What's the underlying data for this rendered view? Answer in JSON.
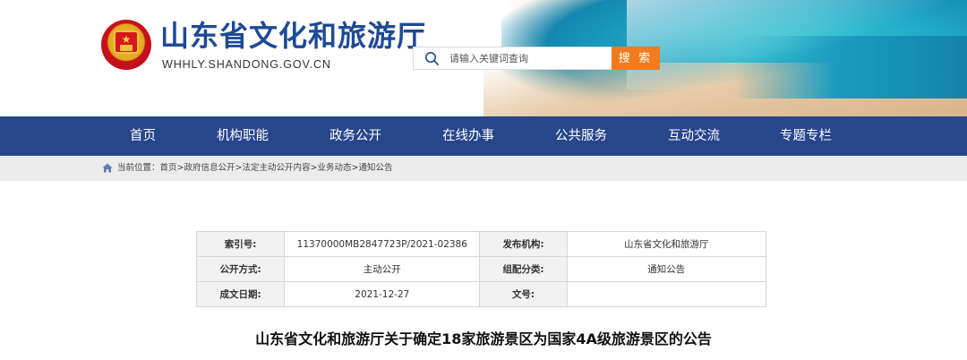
{
  "header": {
    "title": "山东省文化和旅游厅",
    "domain": "WHHLY.SHANDONG.GOV.CN",
    "search": {
      "placeholder": "请输入关键词查询",
      "button_label": "搜 索"
    },
    "colors": {
      "title": "#1e4a96",
      "search_button": "#f27b20"
    }
  },
  "nav": {
    "background": "#27468c",
    "items": [
      "首页",
      "机构职能",
      "政务公开",
      "在线办事",
      "公共服务",
      "互动交流",
      "专题专栏"
    ]
  },
  "breadcrumb": {
    "prefix": "当前位置：",
    "items": [
      "首页",
      "政府信息公开",
      "法定主动公开内容",
      "业务动态",
      "通知公告"
    ],
    "separator": ">"
  },
  "info_table": {
    "rows": [
      {
        "k1": "索引号:",
        "v1": "11370000MB2847723P/2021-02386",
        "k2": "发布机构:",
        "v2": "山东省文化和旅游厅"
      },
      {
        "k1": "公开方式:",
        "v1": "主动公开",
        "k2": "组配分类:",
        "v2": "通知公告"
      },
      {
        "k1": "成文日期:",
        "v1": "2021-12-27",
        "k2": "文号:",
        "v2": ""
      }
    ]
  },
  "article": {
    "title": "山东省文化和旅游厅关于确定18家旅游景区为国家4A级旅游景区的公告"
  }
}
